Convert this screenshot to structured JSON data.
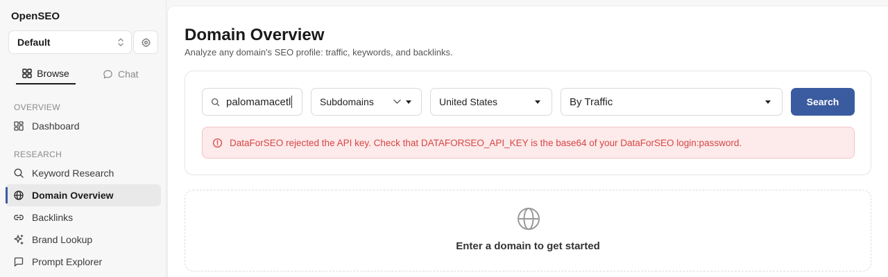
{
  "sidebar": {
    "app_name": "OpenSEO",
    "project": "Default",
    "tabs": {
      "browse": "Browse",
      "chat": "Chat"
    },
    "sections": {
      "overview": "OVERVIEW",
      "research": "RESEARCH"
    },
    "items": [
      {
        "label": "Dashboard",
        "icon": "dashboard-icon"
      },
      {
        "label": "Keyword Research",
        "icon": "search-icon"
      },
      {
        "label": "Domain Overview",
        "icon": "globe-icon",
        "active": true
      },
      {
        "label": "Backlinks",
        "icon": "link-icon"
      },
      {
        "label": "Brand Lookup",
        "icon": "sparkles-icon"
      },
      {
        "label": "Prompt Explorer",
        "icon": "message-square-icon"
      }
    ]
  },
  "main": {
    "title": "Domain Overview",
    "subtitle": "Analyze any domain's SEO profile: traffic, keywords, and backlinks.",
    "form": {
      "domain_value": "palomamacetl",
      "subdomains_option": "Subdomains",
      "country_option": "United States",
      "sort_option": "By Traffic",
      "search_label": "Search"
    },
    "error_message": "DataForSEO rejected the API key. Check that DATAFORSEO_API_KEY is the base64 of your DataForSEO login:password.",
    "empty_state": "Enter a domain to get started"
  },
  "colors": {
    "accent": "#3a5ba0",
    "error_text": "#d64545",
    "error_bg": "#fdeaea"
  }
}
